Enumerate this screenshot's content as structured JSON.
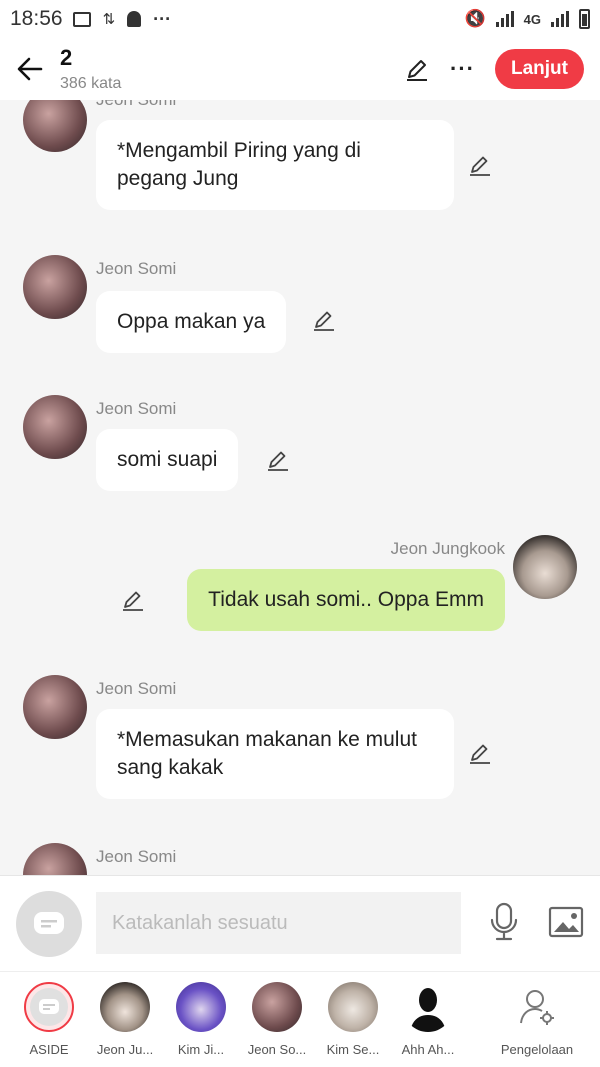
{
  "status_bar": {
    "time": "18:56",
    "network": "4G"
  },
  "header": {
    "title": "2",
    "subtitle": "386 kata",
    "next_label": "Lanjut"
  },
  "messages": [
    {
      "name": "Jeon Somi",
      "text": "*Mengambil Piring yang di pegang Jung",
      "side": "left"
    },
    {
      "name": "Jeon Somi",
      "text": "Oppa makan ya",
      "side": "left"
    },
    {
      "name": "Jeon Somi",
      "text": "somi suapi",
      "side": "left"
    },
    {
      "name": "Jeon Jungkook",
      "text": "Tidak usah somi.. Oppa Emm",
      "side": "right"
    },
    {
      "name": "Jeon Somi",
      "text": "*Memasukan makanan ke mulut sang kakak",
      "side": "left"
    },
    {
      "name": "Jeon Somi",
      "text": "",
      "side": "left"
    }
  ],
  "input": {
    "placeholder": "Katakanlah sesuatu"
  },
  "characters": [
    {
      "label": "ASIDE"
    },
    {
      "label": "Jeon Ju..."
    },
    {
      "label": "Kim Ji..."
    },
    {
      "label": "Jeon So..."
    },
    {
      "label": "Kim Se..."
    },
    {
      "label": "Ahh Ah..."
    },
    {
      "label": "Pengelolaan"
    }
  ],
  "colors": {
    "accent": "#f03b45",
    "my_bubble": "#d4f0a0",
    "background": "#f5f5f5"
  }
}
